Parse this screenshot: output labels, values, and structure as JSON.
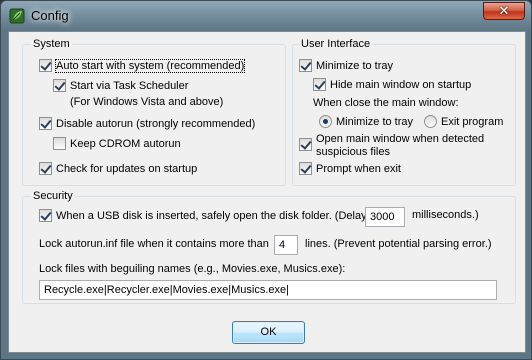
{
  "window": {
    "title": "Config",
    "close_symbol": "✕",
    "app_icon": "leaf-icon",
    "close_color": "#c7381c"
  },
  "system": {
    "legend": "System",
    "auto_start": {
      "label": "Auto start with system (recommended)",
      "checked": true
    },
    "task_scheduler": {
      "label": "Start via Task Scheduler",
      "checked": true
    },
    "task_scheduler_note": "(For Windows Vista and above)",
    "disable_autorun": {
      "label": "Disable autorun (strongly recommended)",
      "checked": true
    },
    "keep_cdrom": {
      "label": "Keep CDROM autorun",
      "checked": false
    },
    "check_updates": {
      "label": "Check for updates on startup",
      "checked": true
    }
  },
  "ui": {
    "legend": "User Interface",
    "minimize_tray": {
      "label": "Minimize to tray",
      "checked": true
    },
    "hide_main": {
      "label": "Hide main window on startup",
      "checked": true
    },
    "close_heading": "When close the main window:",
    "radio_minimize": {
      "label": "Minimize to tray",
      "checked": true
    },
    "radio_exit": {
      "label": "Exit program",
      "checked": false
    },
    "open_main_line1": "Open main window when detected",
    "open_main_line2": "suspicious files",
    "open_main_checked": true,
    "prompt_exit": {
      "label": "Prompt when exit",
      "checked": true
    }
  },
  "security": {
    "legend": "Security",
    "usb_label": "When a USB disk is inserted, safely open the disk folder. (Delay",
    "usb_checked": true,
    "delay_value": "3000",
    "delay_unit": "milliseconds.)",
    "lock_autorun_label": "Lock autorun.inf file when it contains more than",
    "lines_value": "4",
    "lines_suffix": "lines. (Prevent potential parsing error.)",
    "beguiling_label": "Lock files with beguiling names (e.g., Movies.exe, Musics.exe):",
    "beguiling_value": "Recycle.exe|Recycler.exe|Movies.exe|Musics.exe|"
  },
  "buttons": {
    "ok": "OK"
  }
}
